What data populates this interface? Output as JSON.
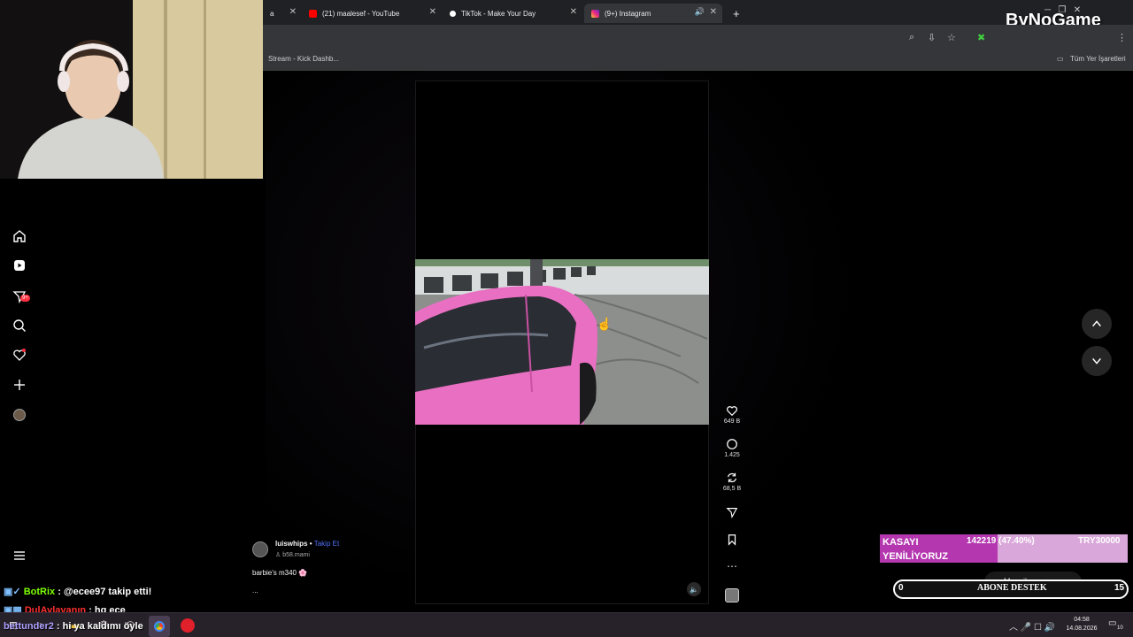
{
  "browser": {
    "tabs": [
      {
        "title": "a",
        "favicon_color": "#9aa0a6"
      },
      {
        "title": "(21) maalesef - YouTube",
        "favicon_color": "#ff0000"
      },
      {
        "title": "TikTok - Make Your Day",
        "favicon_color": "#ffffff"
      },
      {
        "title": "(9+) Instagram",
        "favicon_color": "#e1306c"
      }
    ],
    "bookmarks": {
      "item": "Stream - Kick Dashb...",
      "all": "Tüm Yer İşaretleri"
    },
    "watermark": "ByNoGame"
  },
  "sidebar": {
    "icons": [
      "home-icon",
      "reels-icon",
      "messages-icon",
      "search-icon",
      "notifications-icon",
      "create-icon",
      "profile-icon"
    ],
    "messages_badge": "9+",
    "more_icon": "menu-icon"
  },
  "post": {
    "username": "luiswhips",
    "separator": "•",
    "follow": "Takip Et",
    "audio": "b58.mami",
    "caption": "barbie's m340 🌸",
    "caption_more": "..."
  },
  "actions": {
    "likes": "649 B",
    "comments": "1.425",
    "reposts": "68,5 B"
  },
  "chat": [
    {
      "user": "BotRix",
      "user_color": "#7fff00",
      "message": ": @ecee97 takip etti!"
    },
    {
      "user": "DulAvlayanın",
      "user_color": "#ff3030",
      "message": ": hg ece"
    },
    {
      "user": "bettunder2",
      "user_color": "#b0a0ff",
      "message": ": hi ya kaldımı öyle"
    }
  ],
  "donation": {
    "label_line1": "KASAYI",
    "label_line2": "YENİLİYORUZ",
    "amount": "142219 (47.40%)",
    "goal": "TRY30000",
    "fraction": 0.474
  },
  "subscribe": {
    "current": "0",
    "label": "ABONE DESTEK",
    "target": "15",
    "messages_label": "Mesajlar"
  },
  "taskbar": {
    "time": "04:58",
    "date": "14.08.2026",
    "notif_count": "10"
  },
  "colors": {
    "accent_pink": "#b437b0",
    "link_blue": "#4f6ff6"
  }
}
